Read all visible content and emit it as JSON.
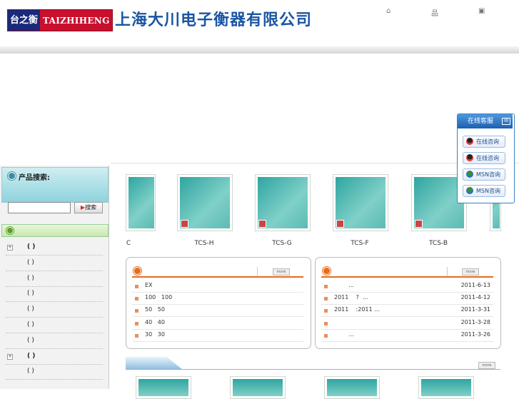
{
  "header": {
    "logo_cn": "台之衡",
    "logo_en": "TAIZHIHENG",
    "company": "上海大川电子衡器有限公司",
    "top_icons": [
      "home-icon",
      "sitemap-icon",
      "bookmark-icon"
    ]
  },
  "sidebar": {
    "search_title": "产品搜索:",
    "search_input_value": "",
    "search_button": "搜索",
    "categories": [
      {
        "label": "(  )",
        "expandable": true
      },
      {
        "label": "(  )",
        "expandable": false
      },
      {
        "label": "(  )",
        "expandable": false
      },
      {
        "label": "(  )",
        "expandable": false
      },
      {
        "label": "(  )",
        "expandable": false
      },
      {
        "label": "(  )",
        "expandable": false
      },
      {
        "label": "(  )",
        "expandable": false
      },
      {
        "label": "(  )",
        "expandable": true
      },
      {
        "label": "( )",
        "expandable": false
      }
    ]
  },
  "products": [
    {
      "name": "C"
    },
    {
      "name": "TCS-H"
    },
    {
      "name": "TCS-G"
    },
    {
      "name": "TCS-F"
    },
    {
      "name": "TCS-B"
    }
  ],
  "panels": [
    {
      "more": "more",
      "rows": [
        {
          "text": "EX",
          "date": ""
        },
        {
          "text": "100   100",
          "date": ""
        },
        {
          "text": "50   50",
          "date": ""
        },
        {
          "text": "40   40",
          "date": ""
        },
        {
          "text": "30   30",
          "date": ""
        }
      ]
    },
    {
      "more": "more",
      "rows": [
        {
          "text": "        ...",
          "date": "2011-6-13"
        },
        {
          "text": "2011    ?  ...",
          "date": "2011-4-12"
        },
        {
          "text": "2011    :2011 ...",
          "date": "2011-3-31"
        },
        {
          "text": "",
          "date": "2011-3-28"
        },
        {
          "text": "        ...",
          "date": "2011-3-26"
        }
      ]
    }
  ],
  "bottom": {
    "more": "more"
  },
  "service": {
    "title": "在线客服",
    "buttons": [
      {
        "label": "在线咨询",
        "icon": "qq-icon"
      },
      {
        "label": "在线咨询",
        "icon": "qq-icon"
      },
      {
        "label": "MSN咨询",
        "icon": "msn-icon"
      },
      {
        "label": "MSN咨询",
        "icon": "msn-icon"
      }
    ]
  },
  "colors": {
    "brand_blue": "#1b55a3",
    "logo_red": "#c8102e",
    "accent_orange": "#e86a1a",
    "teal": "#2fa5a0"
  }
}
